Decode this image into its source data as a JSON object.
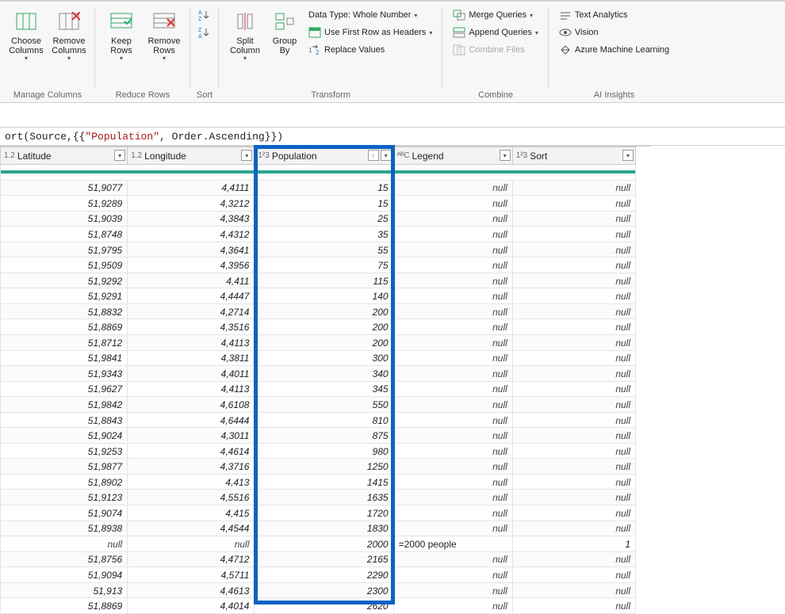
{
  "ribbon": {
    "manage_columns": {
      "choose": "Choose Columns",
      "remove": "Remove Columns",
      "label": "Manage Columns"
    },
    "reduce_rows": {
      "keep": "Keep Rows",
      "remove": "Remove Rows",
      "label": "Reduce Rows"
    },
    "sort": {
      "label": "Sort"
    },
    "transform": {
      "split": "Split Column",
      "group": "Group By",
      "datatype": "Data Type: Whole Number",
      "first_row": "Use First Row as Headers",
      "replace": "Replace Values",
      "label": "Transform"
    },
    "combine": {
      "merge": "Merge Queries",
      "append": "Append Queries",
      "combine": "Combine Files",
      "label": "Combine"
    },
    "ai": {
      "text": "Text Analytics",
      "vision": "Vision",
      "ml": "Azure Machine Learning",
      "label": "AI Insights"
    }
  },
  "formula": {
    "prefix": "ort(Source,{{",
    "str": "\"Population\"",
    "suffix": ", Order.Ascending}})"
  },
  "columns": [
    {
      "name": "Latitude",
      "type_icon": "1.2"
    },
    {
      "name": "Longitude",
      "type_icon": "1.2"
    },
    {
      "name": "Population",
      "type_icon": "1²3",
      "sorted": "asc"
    },
    {
      "name": "Legend",
      "type_icon": "ᴬᴮC"
    },
    {
      "name": "Sort",
      "type_icon": "1²3"
    }
  ],
  "rows": [
    {
      "lat": "51,9077",
      "lon": "4,4111",
      "pop": "15",
      "legend": null,
      "sort": null
    },
    {
      "lat": "51,9289",
      "lon": "4,3212",
      "pop": "15",
      "legend": null,
      "sort": null
    },
    {
      "lat": "51,9039",
      "lon": "4,3843",
      "pop": "25",
      "legend": null,
      "sort": null
    },
    {
      "lat": "51,8748",
      "lon": "4,4312",
      "pop": "35",
      "legend": null,
      "sort": null
    },
    {
      "lat": "51,9795",
      "lon": "4,3641",
      "pop": "55",
      "legend": null,
      "sort": null
    },
    {
      "lat": "51,9509",
      "lon": "4,3956",
      "pop": "75",
      "legend": null,
      "sort": null
    },
    {
      "lat": "51,9292",
      "lon": "4,411",
      "pop": "115",
      "legend": null,
      "sort": null
    },
    {
      "lat": "51,9291",
      "lon": "4,4447",
      "pop": "140",
      "legend": null,
      "sort": null
    },
    {
      "lat": "51,8832",
      "lon": "4,2714",
      "pop": "200",
      "legend": null,
      "sort": null
    },
    {
      "lat": "51,8869",
      "lon": "4,3516",
      "pop": "200",
      "legend": null,
      "sort": null
    },
    {
      "lat": "51,8712",
      "lon": "4,4113",
      "pop": "200",
      "legend": null,
      "sort": null
    },
    {
      "lat": "51,9841",
      "lon": "4,3811",
      "pop": "300",
      "legend": null,
      "sort": null
    },
    {
      "lat": "51,9343",
      "lon": "4,4011",
      "pop": "340",
      "legend": null,
      "sort": null
    },
    {
      "lat": "51,9627",
      "lon": "4,4113",
      "pop": "345",
      "legend": null,
      "sort": null
    },
    {
      "lat": "51,9842",
      "lon": "4,6108",
      "pop": "550",
      "legend": null,
      "sort": null
    },
    {
      "lat": "51,8843",
      "lon": "4,6444",
      "pop": "810",
      "legend": null,
      "sort": null
    },
    {
      "lat": "51,9024",
      "lon": "4,3011",
      "pop": "875",
      "legend": null,
      "sort": null
    },
    {
      "lat": "51,9253",
      "lon": "4,4614",
      "pop": "980",
      "legend": null,
      "sort": null
    },
    {
      "lat": "51,9877",
      "lon": "4,3716",
      "pop": "1250",
      "legend": null,
      "sort": null
    },
    {
      "lat": "51,8902",
      "lon": "4,413",
      "pop": "1415",
      "legend": null,
      "sort": null
    },
    {
      "lat": "51,9123",
      "lon": "4,5516",
      "pop": "1635",
      "legend": null,
      "sort": null
    },
    {
      "lat": "51,9074",
      "lon": "4,415",
      "pop": "1720",
      "legend": null,
      "sort": null
    },
    {
      "lat": "51,8938",
      "lon": "4,4544",
      "pop": "1830",
      "legend": null,
      "sort": null
    },
    {
      "lat": null,
      "lon": null,
      "pop": "2000",
      "legend": "=2000 people",
      "sort": "1"
    },
    {
      "lat": "51,8756",
      "lon": "4,4712",
      "pop": "2165",
      "legend": null,
      "sort": null
    },
    {
      "lat": "51,9094",
      "lon": "4,5711",
      "pop": "2290",
      "legend": null,
      "sort": null
    },
    {
      "lat": "51,913",
      "lon": "4,4613",
      "pop": "2300",
      "legend": null,
      "sort": null
    },
    {
      "lat": "51,8869",
      "lon": "4,4014",
      "pop": "2620",
      "legend": null,
      "sort": null
    }
  ],
  "null_text": "null"
}
